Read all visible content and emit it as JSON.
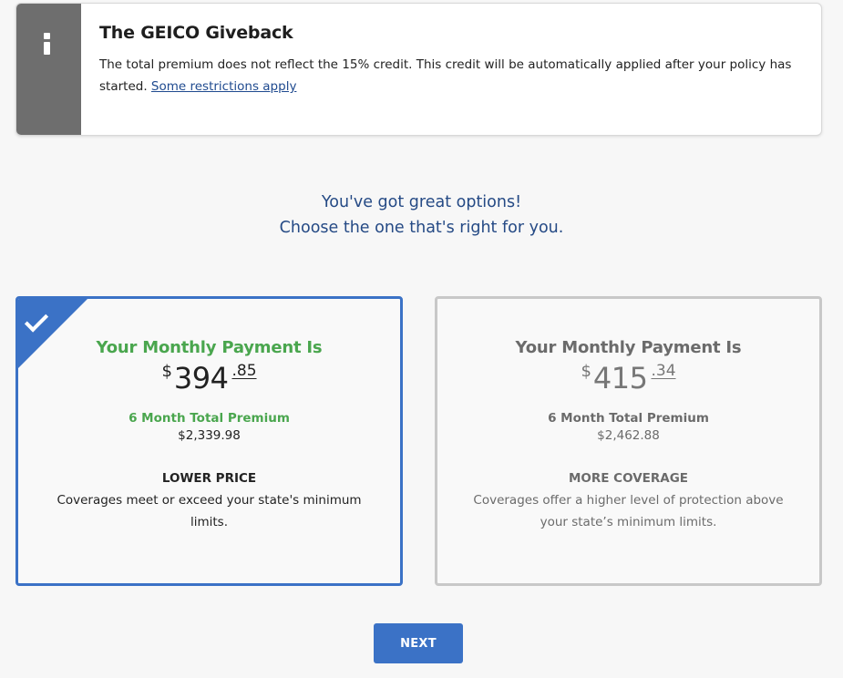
{
  "notice": {
    "title": "The GEICO Giveback",
    "text": "The total premium does not reflect the 15% credit. This credit will be automatically applied after your policy has started.",
    "link": "Some restrictions apply",
    "icon": "info-icon"
  },
  "heading": {
    "line1": "You've got great options!",
    "line2": "Choose the one that's right for you."
  },
  "options": [
    {
      "selected": true,
      "label": "Your Monthly Payment Is",
      "currency": "$",
      "dollars": "394",
      "cents": ".85",
      "term_label": "6 Month Total Premium",
      "term_total": "$2,339.98",
      "kind": "LOWER PRICE",
      "description": "Coverages meet or exceed your state's minimum limits."
    },
    {
      "selected": false,
      "label": "Your Monthly Payment Is",
      "currency": "$",
      "dollars": "415",
      "cents": ".34",
      "term_label": "6 Month Total Premium",
      "term_total": "$2,462.88",
      "kind": "MORE COVERAGE",
      "description": "Coverages offer a higher level of protection above your state’s minimum limits."
    }
  ],
  "next_label": "NEXT",
  "colors": {
    "brand_blue": "#3b72c6",
    "heading_blue": "#254a85",
    "selected_green": "#4aa64e",
    "muted_gray": "#6b6b6b"
  }
}
